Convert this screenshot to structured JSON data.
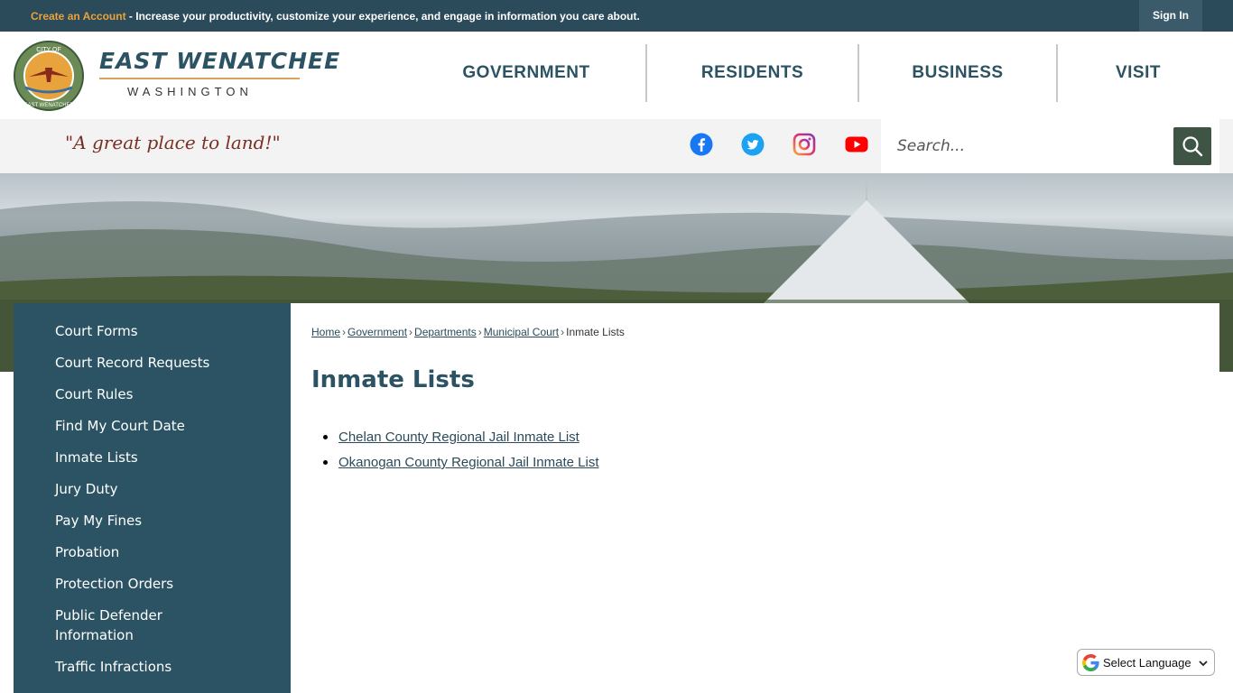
{
  "topbar": {
    "create_account": "Create an Account",
    "account_tagline": " - Increase your productivity, customize your experience, and engage in information you care about.",
    "sign_in": "Sign In"
  },
  "header": {
    "logo_city": "EAST WENATCHEE",
    "logo_state": "WASHINGTON",
    "logo_seal_text": "CITY OF EAST WENATCHEE",
    "nav": [
      "GOVERNMENT",
      "RESIDENTS",
      "BUSINESS",
      "VISIT"
    ]
  },
  "utility": {
    "slogan": "\"A great place to land!\"",
    "social": [
      "facebook-icon",
      "twitter-icon",
      "instagram-icon",
      "youtube-icon"
    ],
    "search_placeholder": "Search..."
  },
  "sidebar": {
    "items": [
      {
        "label": "Court Forms"
      },
      {
        "label": "Court Record Requests"
      },
      {
        "label": "Court Rules"
      },
      {
        "label": "Find My Court Date"
      },
      {
        "label": "Inmate Lists"
      },
      {
        "label": "Jury Duty"
      },
      {
        "label": "Pay My Fines"
      },
      {
        "label": "Probation"
      },
      {
        "label": "Protection Orders"
      },
      {
        "label": "Public Defender Information"
      },
      {
        "label": "Traffic Infractions"
      }
    ]
  },
  "breadcrumb": {
    "items": [
      "Home",
      "Government",
      "Departments",
      "Municipal Court"
    ],
    "current": "Inmate Lists",
    "separator": "›"
  },
  "main": {
    "title": "Inmate Lists",
    "links": [
      "Chelan County Regional Jail Inmate List",
      "Okanogan County Regional Jail Inmate List"
    ]
  },
  "translate": {
    "label": "Select Language"
  },
  "colors": {
    "brand_teal": "#2b5363",
    "topbar": "#2b4a5a",
    "accent_orange": "#e8a33c",
    "search_button": "#3e5546",
    "slogan": "#7a2f22"
  }
}
